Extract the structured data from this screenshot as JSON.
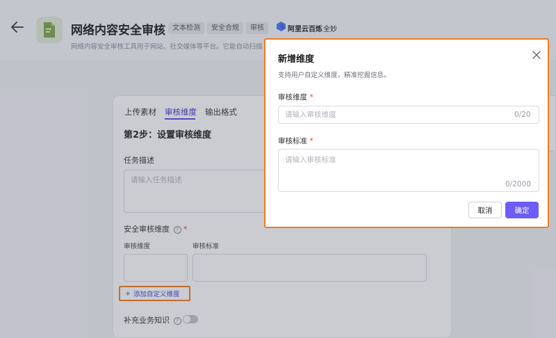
{
  "header": {
    "title": "网络内容安全审核",
    "tags": [
      "文本检测",
      "安全合规",
      "审核"
    ],
    "brand": "阿里云百炼",
    "brand_sub": "全妙",
    "description": "网络内容安全审核工具用于网站、社交媒体等平台。它能自动扫描"
  },
  "card": {
    "tabs": [
      "上传素材",
      "审核维度",
      "输出格式"
    ],
    "active_tab": 1,
    "step_title": "第2步：设置审核维度",
    "task_label": "任务描述",
    "task_placeholder": "请输入任务描述",
    "dimension_section_label": "安全审核维度",
    "help_mark": "?",
    "required_mark": "*",
    "col_dimension": "审核维度",
    "col_standard": "审核标准",
    "add_link": "添加自定义维度",
    "add_icon": "+",
    "knowledge_label": "补充业务知识"
  },
  "modal": {
    "title": "新增维度",
    "subtitle": "支持用户自定义维度，精准挖掘信息。",
    "dimension_label": "审核维度",
    "dimension_placeholder": "请输入审核维度",
    "dimension_counter": "0/20",
    "standard_label": "审核标准",
    "standard_placeholder": "请输入审核标准",
    "standard_counter": "0/2000",
    "required_mark": "*",
    "cancel_label": "取消",
    "ok_label": "确定"
  },
  "colors": {
    "accent": "#6d5cf6",
    "highlight_border": "#f07c1e",
    "required": "#e23c3c"
  },
  "icons": {
    "back": "arrow-left-icon",
    "app": "document-check-icon",
    "brand": "bailian-logo-icon",
    "close": "close-icon",
    "help": "question-circle-icon",
    "add": "plus-icon"
  }
}
